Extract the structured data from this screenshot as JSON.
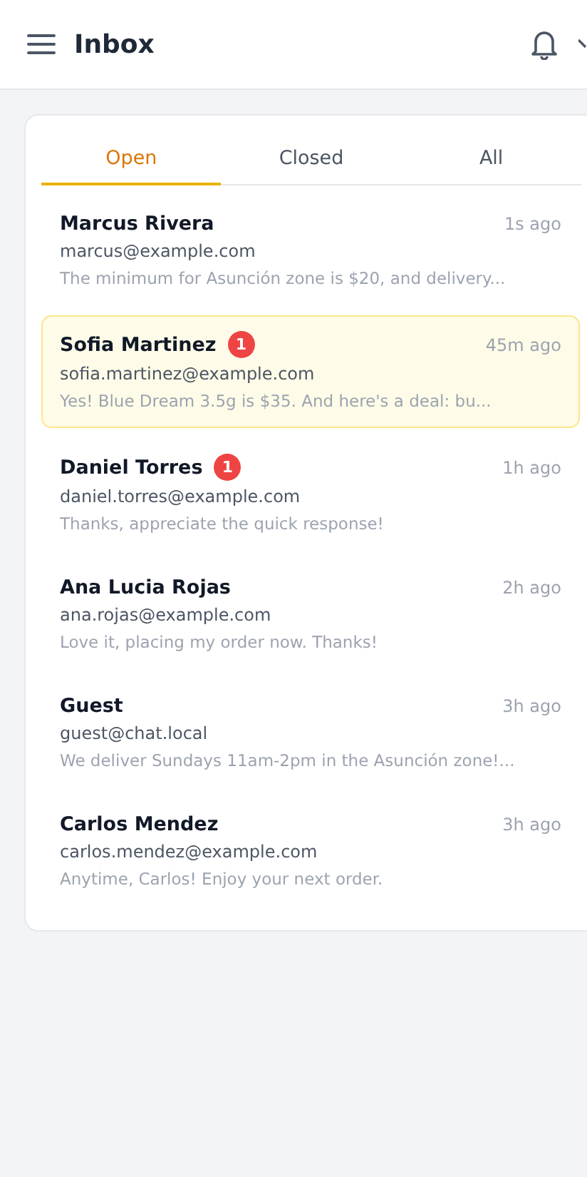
{
  "header": {
    "title": "Inbox"
  },
  "tabs": [
    {
      "label": "Open",
      "selected": true
    },
    {
      "label": "Closed",
      "selected": false
    },
    {
      "label": "All",
      "selected": false
    }
  ],
  "conversations": [
    {
      "name": "Marcus Rivera",
      "email": "marcus@example.com",
      "preview": "The minimum for Asunción zone is $20, and delivery...",
      "time": "1s ago",
      "selected": false
    },
    {
      "name": "Sofia Martinez",
      "badge": "1",
      "email": "sofia.martinez@example.com",
      "preview": "Yes! Blue Dream 3.5g is $35. And here's a deal: bu...",
      "time": "45m ago",
      "selected": true
    },
    {
      "name": "Daniel Torres",
      "badge": "1",
      "email": "daniel.torres@example.com",
      "preview": "Thanks, appreciate the quick response!",
      "time": "1h ago",
      "selected": false
    },
    {
      "name": "Ana Lucia Rojas",
      "email": "ana.rojas@example.com",
      "preview": "Love it, placing my order now. Thanks!",
      "time": "2h ago",
      "selected": false
    },
    {
      "name": "Guest",
      "email": "guest@chat.local",
      "preview": "We deliver Sundays 11am-2pm in the Asunción zone!...",
      "time": "3h ago",
      "selected": false
    },
    {
      "name": "Carlos Mendez",
      "email": "carlos.mendez@example.com",
      "preview": "Anytime, Carlos! Enjoy your next order.",
      "time": "3h ago",
      "selected": false
    }
  ]
}
